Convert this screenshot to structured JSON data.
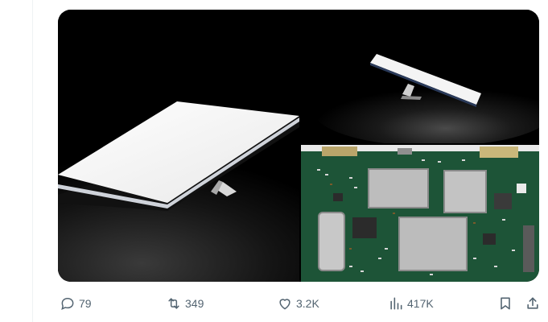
{
  "tweet": {
    "media": [
      {
        "name": "tablet-device-photo",
        "icon": "photo"
      },
      {
        "name": "tablet-device-angle-photo",
        "icon": "photo"
      },
      {
        "name": "circuit-board-photo",
        "icon": "photo"
      }
    ],
    "actions": {
      "reply": {
        "icon": "reply-icon",
        "count": "79"
      },
      "retweet": {
        "icon": "retweet-icon",
        "count": "349"
      },
      "like": {
        "icon": "heart-icon",
        "count": "3.2K"
      },
      "views": {
        "icon": "views-icon",
        "count": "417K"
      },
      "bookmark": {
        "icon": "bookmark-icon"
      },
      "share": {
        "icon": "share-icon"
      }
    }
  },
  "colors": {
    "icon_gray": "#536471",
    "border": "#eff3f4",
    "media_bg": "#000000",
    "pcb_green": "#1f5a3a"
  }
}
